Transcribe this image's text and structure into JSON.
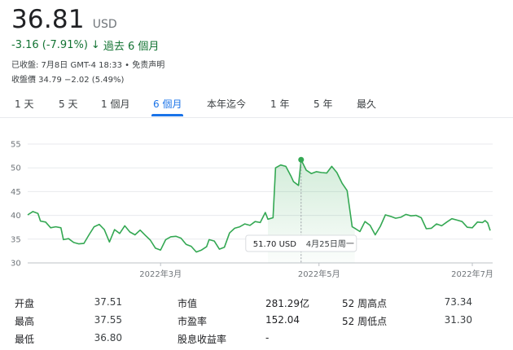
{
  "quote": {
    "price": "36.81",
    "currency": "USD",
    "change": "-3.16 (-7.91%)",
    "change_arrow": "↓",
    "change_period": "過去 6 個月",
    "close_info": "已收盤: 7月8日 GMT-4 18:33 • 免责声明",
    "after_hours": "收盤價 34.79 −2.02 (5.49%)"
  },
  "tabs": [
    {
      "label": "1 天"
    },
    {
      "label": "5 天"
    },
    {
      "label": "1 個月"
    },
    {
      "label": "6 個月",
      "active": true
    },
    {
      "label": "本年迄今"
    },
    {
      "label": "1 年"
    },
    {
      "label": "5 年"
    },
    {
      "label": "最久"
    }
  ],
  "tooltip": {
    "value": "51.70 USD",
    "date": "4月25日周一"
  },
  "colors": {
    "line": "#34a853",
    "accent": "#1a73e8",
    "down": "#137333"
  },
  "chart_data": {
    "type": "area",
    "title": "",
    "xlabel": "",
    "ylabel": "",
    "ylim": [
      30,
      55
    ],
    "yticks": [
      55,
      50,
      45,
      40,
      35,
      30
    ],
    "xtick_labels": [
      "2022年3月",
      "2022年5月",
      "2022年7月"
    ],
    "xtick_dates": [
      "2022-03-01",
      "2022-05-02",
      "2022-07-01"
    ],
    "x_range": [
      "2022-01-08",
      "2022-07-08"
    ],
    "highlight": {
      "date": "2022-04-25",
      "value": 51.7
    },
    "series": [
      {
        "points": [
          [
            "2022-01-08",
            40.1
          ],
          [
            "2022-01-10",
            40.8
          ],
          [
            "2022-01-12",
            40.4
          ],
          [
            "2022-01-13",
            38.8
          ],
          [
            "2022-01-15",
            38.6
          ],
          [
            "2022-01-17",
            37.4
          ],
          [
            "2022-01-19",
            37.6
          ],
          [
            "2022-01-21",
            37.4
          ],
          [
            "2022-01-22",
            34.9
          ],
          [
            "2022-01-24",
            35.1
          ],
          [
            "2022-01-26",
            34.3
          ],
          [
            "2022-01-28",
            34.0
          ],
          [
            "2022-01-30",
            34.1
          ],
          [
            "2022-02-01",
            35.9
          ],
          [
            "2022-02-03",
            37.6
          ],
          [
            "2022-02-05",
            38.1
          ],
          [
            "2022-02-07",
            37.0
          ],
          [
            "2022-02-09",
            34.4
          ],
          [
            "2022-02-11",
            37.0
          ],
          [
            "2022-02-13",
            36.2
          ],
          [
            "2022-02-15",
            37.8
          ],
          [
            "2022-02-17",
            36.5
          ],
          [
            "2022-02-19",
            35.9
          ],
          [
            "2022-02-21",
            36.9
          ],
          [
            "2022-02-23",
            35.8
          ],
          [
            "2022-02-25",
            34.8
          ],
          [
            "2022-02-27",
            33.1
          ],
          [
            "2022-03-01",
            32.7
          ],
          [
            "2022-03-03",
            34.9
          ],
          [
            "2022-03-05",
            35.5
          ],
          [
            "2022-03-07",
            35.6
          ],
          [
            "2022-03-09",
            35.2
          ],
          [
            "2022-03-11",
            33.9
          ],
          [
            "2022-03-13",
            33.5
          ],
          [
            "2022-03-15",
            32.3
          ],
          [
            "2022-03-17",
            32.7
          ],
          [
            "2022-03-19",
            33.4
          ],
          [
            "2022-03-20",
            34.9
          ],
          [
            "2022-03-22",
            34.6
          ],
          [
            "2022-03-24",
            32.9
          ],
          [
            "2022-03-26",
            33.3
          ],
          [
            "2022-03-28",
            36.3
          ],
          [
            "2022-03-30",
            37.3
          ],
          [
            "2022-04-01",
            37.6
          ],
          [
            "2022-04-03",
            38.2
          ],
          [
            "2022-04-05",
            37.9
          ],
          [
            "2022-04-07",
            38.7
          ],
          [
            "2022-04-09",
            38.5
          ],
          [
            "2022-04-11",
            40.6
          ],
          [
            "2022-04-12",
            39.2
          ],
          [
            "2022-04-14",
            39.5
          ],
          [
            "2022-04-15",
            50.0
          ],
          [
            "2022-04-17",
            50.6
          ],
          [
            "2022-04-19",
            50.3
          ],
          [
            "2022-04-21",
            48.3
          ],
          [
            "2022-04-22",
            47.1
          ],
          [
            "2022-04-24",
            46.3
          ],
          [
            "2022-04-25",
            51.7
          ],
          [
            "2022-04-27",
            49.5
          ],
          [
            "2022-04-29",
            48.8
          ],
          [
            "2022-05-01",
            49.2
          ],
          [
            "2022-05-03",
            49.0
          ],
          [
            "2022-05-05",
            48.9
          ],
          [
            "2022-05-07",
            50.3
          ],
          [
            "2022-05-09",
            49.0
          ],
          [
            "2022-05-11",
            46.8
          ],
          [
            "2022-05-13",
            45.2
          ],
          [
            "2022-05-15",
            37.6
          ],
          [
            "2022-05-16",
            37.3
          ],
          [
            "2022-05-18",
            36.6
          ],
          [
            "2022-05-20",
            38.7
          ],
          [
            "2022-05-22",
            37.9
          ],
          [
            "2022-05-24",
            35.9
          ],
          [
            "2022-05-26",
            37.7
          ],
          [
            "2022-05-28",
            40.1
          ],
          [
            "2022-05-30",
            39.8
          ],
          [
            "2022-06-01",
            39.4
          ],
          [
            "2022-06-03",
            39.6
          ],
          [
            "2022-06-05",
            40.2
          ],
          [
            "2022-06-07",
            39.9
          ],
          [
            "2022-06-09",
            40.0
          ],
          [
            "2022-06-11",
            39.5
          ],
          [
            "2022-06-13",
            37.2
          ],
          [
            "2022-06-15",
            37.3
          ],
          [
            "2022-06-17",
            38.2
          ],
          [
            "2022-06-19",
            37.8
          ],
          [
            "2022-06-21",
            38.6
          ],
          [
            "2022-06-23",
            39.3
          ],
          [
            "2022-06-25",
            39.0
          ],
          [
            "2022-06-27",
            38.7
          ],
          [
            "2022-06-29",
            37.5
          ],
          [
            "2022-07-01",
            37.4
          ],
          [
            "2022-07-03",
            38.6
          ],
          [
            "2022-07-05",
            38.5
          ],
          [
            "2022-07-06",
            38.9
          ],
          [
            "2022-07-07",
            38.4
          ],
          [
            "2022-07-08",
            36.81
          ]
        ]
      }
    ]
  },
  "stats": {
    "open_label": "开盘",
    "open_value": "37.51",
    "high_label": "最高",
    "high_value": "37.55",
    "low_label": "最低",
    "low_value": "36.80",
    "mktcap_label": "市值",
    "mktcap_value": "281.29亿",
    "pe_label": "市盈率",
    "pe_value": "152.04",
    "div_label": "股息收益率",
    "div_value": "-",
    "high52_label": "52 周高点",
    "high52_value": "73.34",
    "low52_label": "52 周低点",
    "low52_value": "31.30"
  }
}
